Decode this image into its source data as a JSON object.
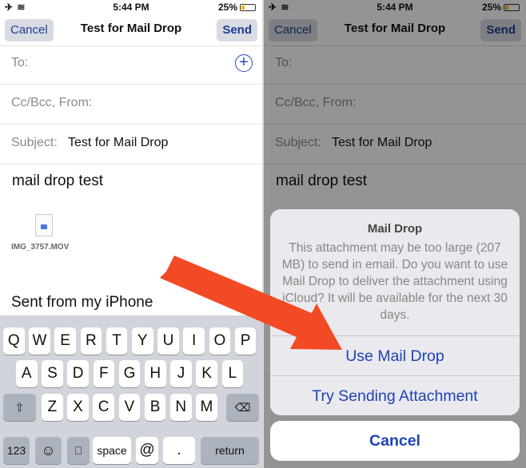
{
  "status": {
    "signal": "✈ ≋",
    "time": "5:44 PM",
    "battery": "25%"
  },
  "nav": {
    "cancel": "Cancel",
    "title": "Test for Mail Drop",
    "send": "Send"
  },
  "fields": {
    "to_label": "To:",
    "ccbcc_label": "Cc/Bcc, From:",
    "subject_label": "Subject:",
    "subject_value": "Test for Mail Drop"
  },
  "message": {
    "body": "mail drop test",
    "attachment_name": "IMG_3757.MOV",
    "signature": "Sent from my iPhone"
  },
  "keyboard": {
    "row1": [
      "Q",
      "W",
      "E",
      "R",
      "T",
      "Y",
      "U",
      "I",
      "O",
      "P"
    ],
    "row2": [
      "A",
      "S",
      "D",
      "F",
      "G",
      "H",
      "J",
      "K",
      "L"
    ],
    "row3": [
      "Z",
      "X",
      "C",
      "V",
      "B",
      "N",
      "M"
    ],
    "numbers": "123",
    "emoji": "☺",
    "mic": "🎙",
    "space": "space",
    "at": "@",
    "period": ".",
    "return": "return",
    "shift": "⇧",
    "delete": "⌫"
  },
  "alert": {
    "title": "Mail Drop",
    "message": "This attachment may be too large (207 MB) to send in email. Do you want to use Mail Drop to deliver the attachment using iCloud? It will be available for the next 30 days.",
    "option_primary": "Use Mail Drop",
    "option_secondary": "Try Sending Attachment",
    "cancel": "Cancel"
  },
  "colors": {
    "accent": "#1e43b4",
    "arrow": "#f24a24",
    "battery": "#f5b400"
  }
}
